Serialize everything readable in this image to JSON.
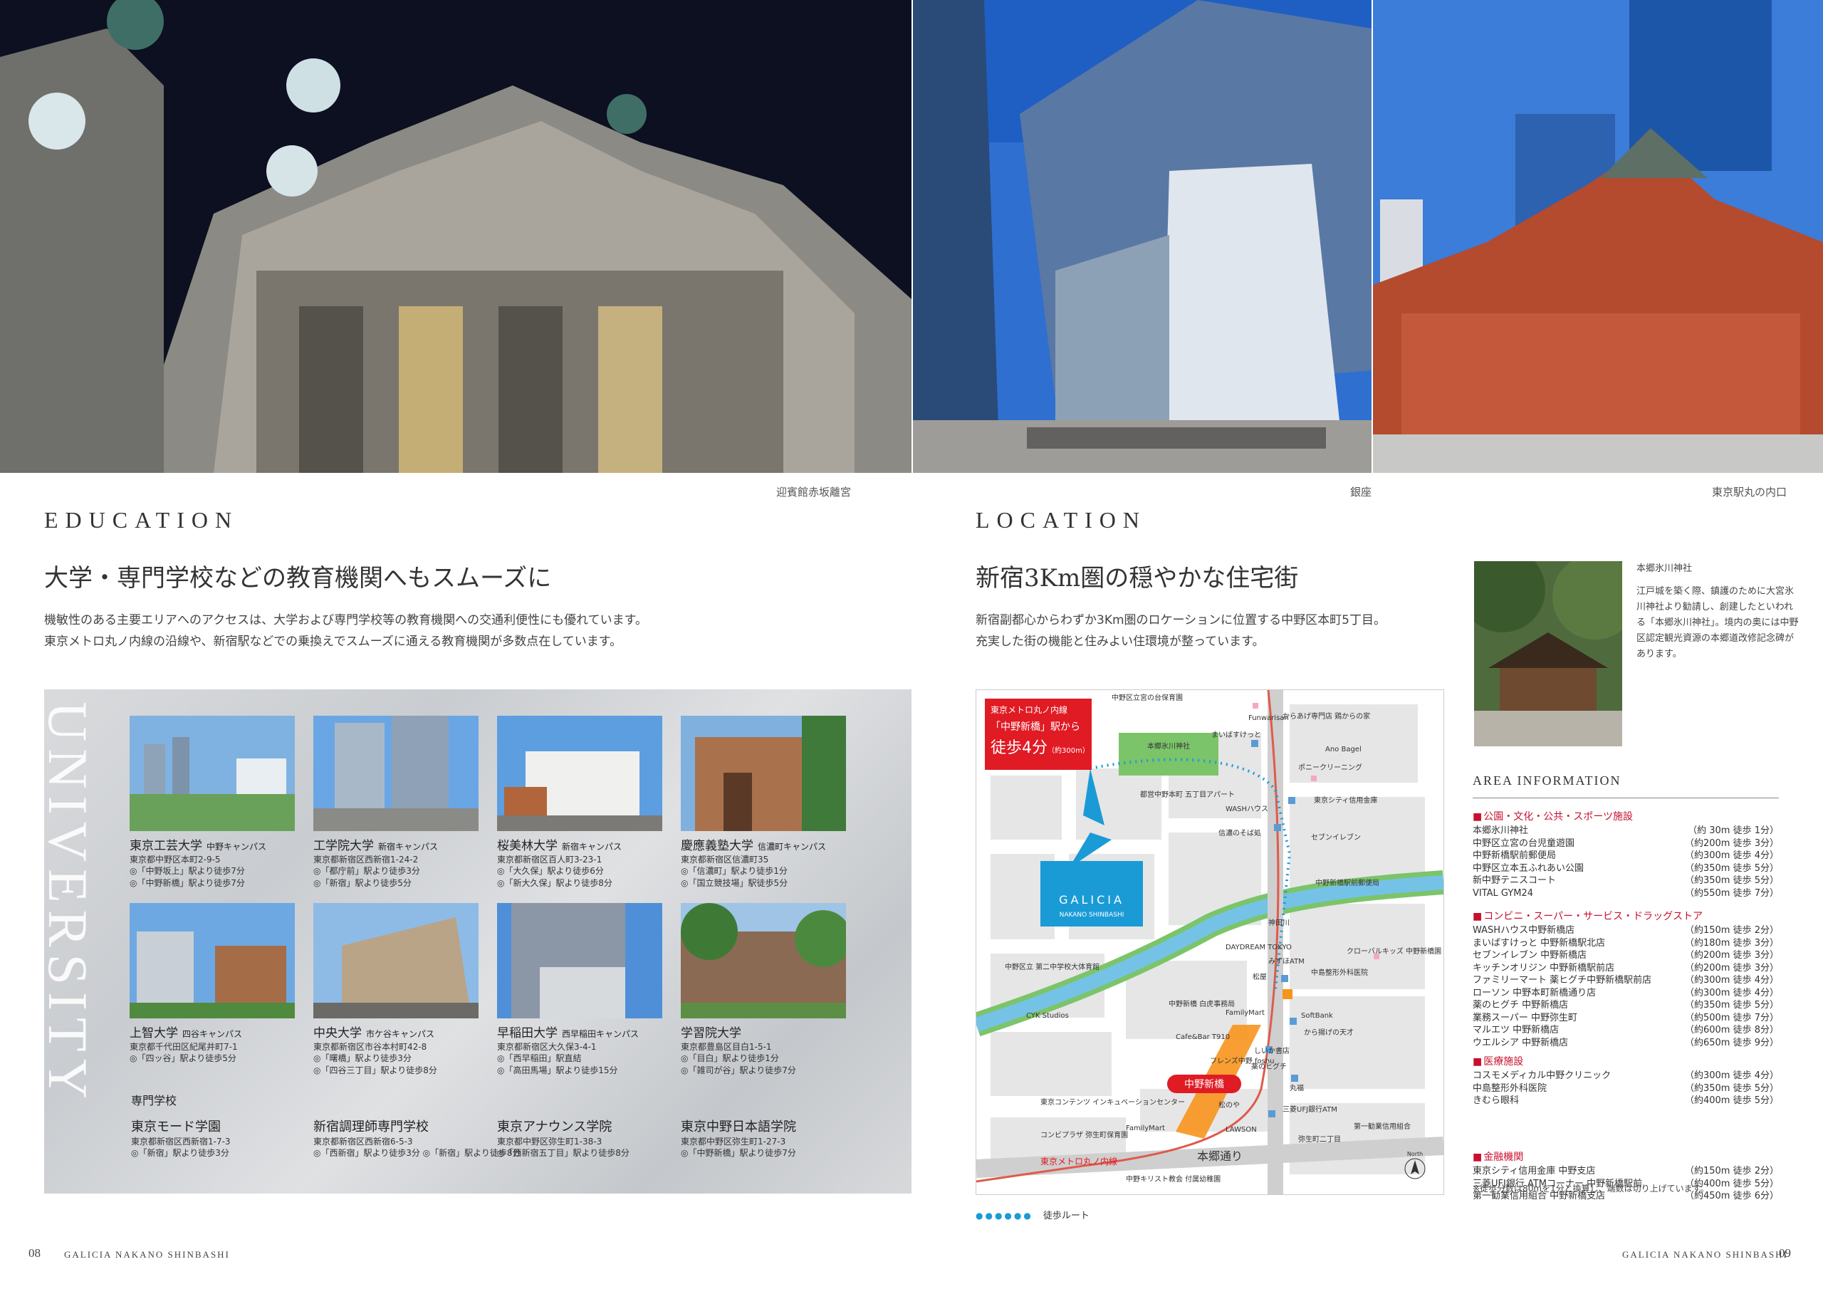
{
  "photos": [
    {
      "caption": "迎賓館赤坂離宮"
    },
    {
      "caption": "銀座"
    },
    {
      "caption": "東京駅丸の内口"
    }
  ],
  "education": {
    "label": "EDUCATION",
    "headline": "大学・専門学校などの教育機関へもスムーズに",
    "body": [
      "機敏性のある主要エリアへのアクセスは、大学および専門学校等の教育機関への交通利便性にも優れています。",
      "東京メトロ丸ノ内線の沿線や、新宿駅などでの乗換えでスムーズに通える教育機関が多数点在しています。"
    ],
    "vertical": "UNIVERSITY etc.",
    "universities": [
      {
        "name": "東京工芸大学",
        "campus": "中野キャンパス",
        "address": "東京都中野区本町2-9-5",
        "access": [
          "◎「中野坂上」駅より徒歩7分",
          "◎「中野新橋」駅より徒歩7分"
        ]
      },
      {
        "name": "工学院大学",
        "campus": "新宿キャンパス",
        "address": "東京都新宿区西新宿1-24-2",
        "access": [
          "◎「都庁前」駅より徒歩3分",
          "◎「新宿」駅より徒歩5分"
        ]
      },
      {
        "name": "桜美林大学",
        "campus": "新宿キャンパス",
        "address": "東京都新宿区百人町3-23-1",
        "access": [
          "◎「大久保」駅より徒歩6分",
          "◎「新大久保」駅より徒歩8分"
        ]
      },
      {
        "name": "慶應義塾大学",
        "campus": "信濃町キャンパス",
        "address": "東京都新宿区信濃町35",
        "access": [
          "◎「信濃町」駅より徒歩1分",
          "◎「国立競技場」駅徒歩5分"
        ]
      },
      {
        "name": "上智大学",
        "campus": "四谷キャンパス",
        "address": "東京都千代田区紀尾井町7-1",
        "access": [
          "◎「四ッ谷」駅より徒歩5分"
        ]
      },
      {
        "name": "中央大学",
        "campus": "市ケ谷キャンパス",
        "address": "東京都新宿区市谷本村町42-8",
        "access": [
          "◎「曙橋」駅より徒歩3分",
          "◎「四谷三丁目」駅より徒歩8分"
        ]
      },
      {
        "name": "早稲田大学",
        "campus": "西早稲田キャンパス",
        "address": "東京都新宿区大久保3-4-1",
        "access": [
          "◎「西早稲田」駅直結",
          "◎「高田馬場」駅より徒歩15分"
        ]
      },
      {
        "name": "学習院大学",
        "campus": "",
        "address": "東京都豊島区目白1-5-1",
        "access": [
          "◎「目白」駅より徒歩1分",
          "◎「雑司が谷」駅より徒歩7分"
        ]
      }
    ],
    "schools_heading": "専門学校",
    "schools": [
      {
        "name": "東京モード学園",
        "address": "東京都新宿区西新宿1-7-3",
        "access": "◎「新宿」駅より徒歩3分"
      },
      {
        "name": "新宿調理師専門学校",
        "address": "東京都新宿区西新宿6-5-3",
        "access": "◎「西新宿」駅より徒歩3分 ◎「新宿」駅より徒歩8分"
      },
      {
        "name": "東京アナウンス学院",
        "address": "東京都中野区弥生町1-38-3",
        "access": "◎「西新宿五丁目」駅より徒歩8分"
      },
      {
        "name": "東京中野日本語学院",
        "address": "東京都中野区弥生町1-27-3",
        "access": "◎「中野新橋」駅より徒歩7分"
      }
    ]
  },
  "location": {
    "label": "LOCATION",
    "headline": "新宿3Km圏の穏やかな住宅街",
    "body": [
      "新宿副都心からわずか3Km圏のロケーションに位置する中野区本町5丁目。",
      "充実した街の機能と住みよい住環境が整っています。"
    ],
    "map": {
      "badge_line1": "東京メトロ丸ノ内線",
      "badge_station": "「中野新橋」駅から",
      "badge_time": "徒歩4分",
      "badge_dist": "（約300m）",
      "brand": "GALICIA",
      "brand_sub": "NAKANO SHINBASHI",
      "station": "中野新橋",
      "road": "本郷通り",
      "line_name": "東京メトロ丸ノ内線",
      "north": "North",
      "labels": [
        "中野区立宮の台保育園",
        "Funwarisan",
        "からあげ専門店 鶏からの家",
        "Ano Bagel",
        "ポニークリーニング",
        "本郷氷川神社",
        "まいばすけっと",
        "東京シティ信用金庫",
        "WASHハウス",
        "セブンイレブン",
        "都営中野本町 五丁目アパート",
        "信濃のそば処",
        "中野新橋駅前郵便局",
        "神田川",
        "DAYDREAM TOKYO",
        "みずほATM",
        "松屋",
        "中島整形外科医院",
        "クローバルキッズ 中野新橋園",
        "中野区立 第二中学校大体育館",
        "中野新橋 白虎事務局",
        "FamilyMart",
        "SoftBank",
        "から揚げの天才",
        "Cafe&Bar T910",
        "フレンズ中野 foshu",
        "しいか書店",
        "薬のヒグチ",
        "CYK Studios",
        "丸福",
        "松のや",
        "三菱UFJ銀行ATM",
        "東京コンテンツ インキュベーションセンター",
        "コンビプラザ 弥生町保育園",
        "FamilyMart",
        "LAWSON",
        "弥生町二丁目",
        "第一勧業信用組合",
        "中野キリスト教会 付属幼稚園"
      ],
      "walk_label": "徒歩ルート"
    },
    "shrine": {
      "title": "本郷氷川神社",
      "text": "江戸城を築く際、鎮護のために大宮氷川神社より勧請し、創建したといわれる「本郷氷川神社」。境内の奥には中野区認定観光資源の本郷道改修記念碑があります。"
    },
    "area_info": {
      "title": "AREA INFORMATION",
      "groups": [
        {
          "category": "公園・文化・公共・スポーツ施設",
          "rows": [
            [
              "本郷氷川神社",
              "（約 30m 徒歩 1分）"
            ],
            [
              "中野区立宮の台児童遊園",
              "（約200m 徒歩 3分）"
            ],
            [
              "中野新橋駅前郵便局",
              "（約300m 徒歩 4分）"
            ],
            [
              "中野区立本五ふれあい公園",
              "（約350m 徒歩 5分）"
            ],
            [
              "新中野テニスコート",
              "（約350m 徒歩 5分）"
            ],
            [
              "VITAL GYM24",
              "（約550m 徒歩 7分）"
            ]
          ]
        },
        {
          "category": "コンビニ・スーパー・サービス・ドラッグストア",
          "rows": [
            [
              "WASHハウス中野新橋店",
              "（約150m 徒歩 2分）"
            ],
            [
              "まいばすけっと 中野新橋駅北店",
              "（約180m 徒歩 3分）"
            ],
            [
              "セブンイレブン 中野新橋店",
              "（約200m 徒歩 3分）"
            ],
            [
              "キッチンオリジン 中野新橋駅前店",
              "（約200m 徒歩 3分）"
            ],
            [
              "ファミリーマート 薬ヒグチ中野新橋駅前店",
              "（約300m 徒歩 4分）"
            ],
            [
              "ローソン 中野本町新橋通り店",
              "（約300m 徒歩 4分）"
            ],
            [
              "薬のヒグチ 中野新橋店",
              "（約350m 徒歩 5分）"
            ],
            [
              "業務スーパー 中野弥生町",
              "（約500m 徒歩 7分）"
            ],
            [
              "マルエツ 中野新橋店",
              "（約600m 徒歩 8分）"
            ],
            [
              "ウエルシア 中野新橋店",
              "（約650m 徒歩 9分）"
            ]
          ]
        },
        {
          "category": "医療施設",
          "rows": [
            [
              "コスモメディカル中野クリニック",
              "（約300m 徒歩 4分）"
            ],
            [
              "中島整形外科医院",
              "（約350m 徒歩 5分）"
            ],
            [
              "きむら眼科",
              "（約400m 徒歩 5分）"
            ]
          ]
        },
        {
          "category": "金融機関",
          "rows": [
            [
              "東京シティ信用金庫 中野支店",
              "（約150m 徒歩 2分）"
            ],
            [
              "三菱UFJ銀行 ATMコーナー 中野新橋駅前",
              "（約400m 徒歩 5分）"
            ],
            [
              "第一勧業信用組合 中野新橋支店",
              "（約450m 徒歩 6分）"
            ]
          ]
        }
      ],
      "note": "※徒歩分数は80mを1分と換算し、端数は切り上げています。"
    }
  },
  "footer": {
    "left_num": "08",
    "left_brand": "GALICIA NAKANO SHINBASHI",
    "right_brand": "GALICIA NAKANO SHINBASHI",
    "right_num": "09"
  }
}
